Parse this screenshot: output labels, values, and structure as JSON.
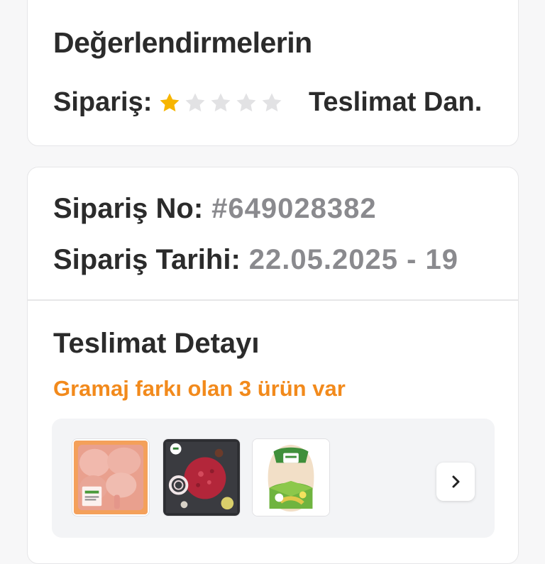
{
  "ratings": {
    "title": "Değerlendirmelerin",
    "order_label": "Sipariş:",
    "order_stars": 1,
    "order_stars_max": 5,
    "delivery_label": "Teslimat Dan."
  },
  "order": {
    "number_label": "Sipariş No:",
    "number_value": "#649028382",
    "date_label": "Sipariş Tarihi:",
    "date_value": "22.05.2025 - 19"
  },
  "delivery": {
    "title": "Teslimat Detayı",
    "weight_note": "Gramaj farkı olan 3 ürün var",
    "products": [
      {
        "name": "chicken-thighs-product-image"
      },
      {
        "name": "ground-beef-product-image"
      },
      {
        "name": "whole-chicken-product-image"
      }
    ],
    "next_icon": "chevron-right-icon"
  },
  "colors": {
    "accent": "#f28a1c",
    "star_filled": "#f7b500",
    "star_empty": "#e2e2e4",
    "muted_text": "#8a8a8e"
  }
}
